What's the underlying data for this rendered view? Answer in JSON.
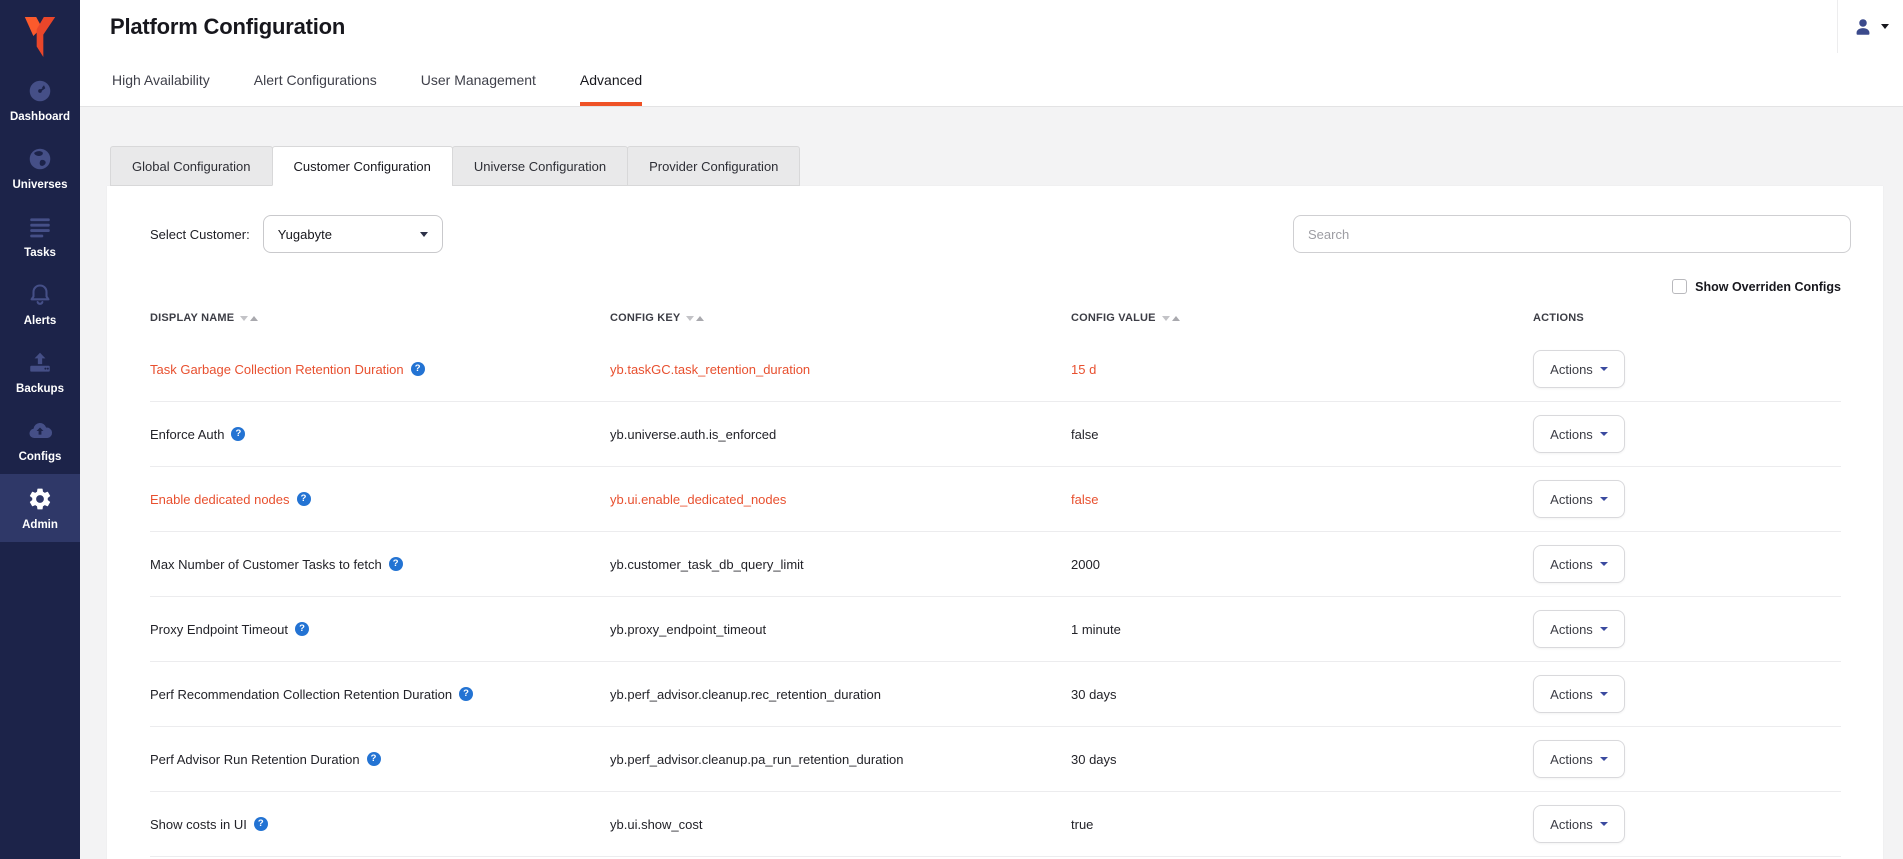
{
  "header": {
    "title": "Platform Configuration"
  },
  "sidebar": {
    "items": [
      {
        "label": "Dashboard",
        "icon": "dashboard-gauge-icon",
        "active": false
      },
      {
        "label": "Universes",
        "icon": "universes-globe-icon",
        "active": false
      },
      {
        "label": "Tasks",
        "icon": "tasks-list-icon",
        "active": false
      },
      {
        "label": "Alerts",
        "icon": "alerts-bell-icon",
        "active": false
      },
      {
        "label": "Backups",
        "icon": "backups-upload-icon",
        "active": false
      },
      {
        "label": "Configs",
        "icon": "configs-cloud-icon",
        "active": false
      },
      {
        "label": "Admin",
        "icon": "admin-gear-icon",
        "active": true
      }
    ]
  },
  "tabs": [
    {
      "label": "High Availability",
      "active": false
    },
    {
      "label": "Alert Configurations",
      "active": false
    },
    {
      "label": "User Management",
      "active": false
    },
    {
      "label": "Advanced",
      "active": true
    }
  ],
  "subtabs": [
    {
      "label": "Global Configuration",
      "active": false
    },
    {
      "label": "Customer Configuration",
      "active": true
    },
    {
      "label": "Universe Configuration",
      "active": false
    },
    {
      "label": "Provider Configuration",
      "active": false
    }
  ],
  "filters": {
    "select_customer_label": "Select Customer:",
    "customer_value": "Yugabyte",
    "search_placeholder": "Search",
    "show_overridden_label": "Show Overriden Configs",
    "show_overridden_checked": false
  },
  "table": {
    "columns": [
      {
        "label": "DISPLAY NAME",
        "sortable": true
      },
      {
        "label": "CONFIG KEY",
        "sortable": true
      },
      {
        "label": "CONFIG VALUE",
        "sortable": true
      },
      {
        "label": "ACTIONS",
        "sortable": false
      }
    ],
    "actions_label": "Actions",
    "rows": [
      {
        "display_name": "Task Garbage Collection Retention Duration",
        "config_key": "yb.taskGC.task_retention_duration",
        "config_value": "15 d",
        "overridden": true
      },
      {
        "display_name": "Enforce Auth",
        "config_key": "yb.universe.auth.is_enforced",
        "config_value": "false",
        "overridden": false
      },
      {
        "display_name": "Enable dedicated nodes",
        "config_key": "yb.ui.enable_dedicated_nodes",
        "config_value": "false",
        "overridden": true
      },
      {
        "display_name": "Max Number of Customer Tasks to fetch",
        "config_key": "yb.customer_task_db_query_limit",
        "config_value": "2000",
        "overridden": false
      },
      {
        "display_name": "Proxy Endpoint Timeout",
        "config_key": "yb.proxy_endpoint_timeout",
        "config_value": "1 minute",
        "overridden": false
      },
      {
        "display_name": "Perf Recommendation Collection Retention Duration",
        "config_key": "yb.perf_advisor.cleanup.rec_retention_duration",
        "config_value": "30 days",
        "overridden": false
      },
      {
        "display_name": "Perf Advisor Run Retention Duration",
        "config_key": "yb.perf_advisor.cleanup.pa_run_retention_duration",
        "config_value": "30 days",
        "overridden": false
      },
      {
        "display_name": "Show costs in UI",
        "config_key": "yb.ui.show_cost",
        "config_value": "true",
        "overridden": false
      }
    ]
  },
  "colors": {
    "accent_orange": "#ef5226",
    "override_red": "#e8502f",
    "help_blue": "#2373d3",
    "sidebar_navy": "#1c2349",
    "sidebar_active_navy": "#2f3868",
    "user_icon_blue": "#3b4a8c"
  }
}
